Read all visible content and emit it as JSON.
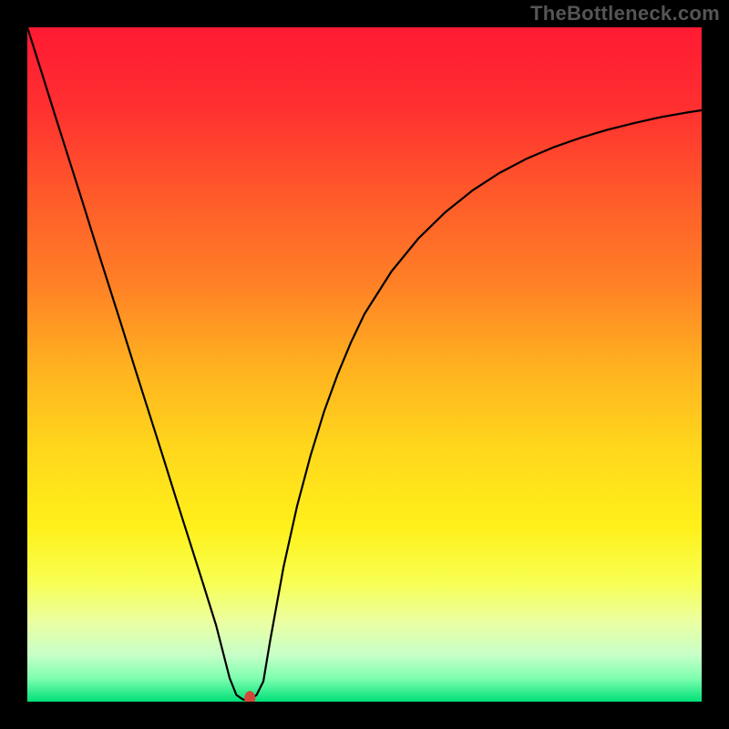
{
  "watermark": "TheBottleneck.com",
  "chart_data": {
    "type": "line",
    "title": "",
    "xlabel": "",
    "ylabel": "",
    "xlim": [
      0,
      100
    ],
    "ylim": [
      0,
      100
    ],
    "grid": false,
    "legend": false,
    "background": {
      "type": "vertical-gradient",
      "stops": [
        {
          "pos": 0.0,
          "color": "#ff1a33"
        },
        {
          "pos": 0.12,
          "color": "#ff3030"
        },
        {
          "pos": 0.25,
          "color": "#ff5a2a"
        },
        {
          "pos": 0.38,
          "color": "#ff8026"
        },
        {
          "pos": 0.5,
          "color": "#ffb020"
        },
        {
          "pos": 0.62,
          "color": "#ffd61c"
        },
        {
          "pos": 0.74,
          "color": "#fff01a"
        },
        {
          "pos": 0.82,
          "color": "#f8ff50"
        },
        {
          "pos": 0.88,
          "color": "#ecffa0"
        },
        {
          "pos": 0.93,
          "color": "#c8ffc8"
        },
        {
          "pos": 0.965,
          "color": "#7fffb0"
        },
        {
          "pos": 1.0,
          "color": "#00e078"
        }
      ]
    },
    "series": [
      {
        "name": "bottleneck-curve",
        "color": "#000000",
        "x": [
          0.0,
          2.0,
          4.0,
          6.0,
          8.0,
          10.0,
          12.0,
          14.0,
          16.0,
          18.0,
          20.0,
          22.0,
          24.0,
          26.0,
          28.0,
          30.0,
          31.0,
          32.0,
          33.0,
          34.0,
          35.0,
          36.0,
          38.0,
          40.0,
          42.0,
          44.0,
          46.0,
          48.0,
          50.0,
          54.0,
          58.0,
          62.0,
          66.0,
          70.0,
          74.0,
          78.0,
          82.0,
          86.0,
          90.0,
          94.0,
          98.0,
          100.0
        ],
        "y": [
          100.0,
          93.7,
          87.3,
          81.0,
          74.7,
          68.3,
          62.0,
          55.7,
          49.3,
          43.0,
          36.7,
          30.3,
          24.0,
          17.7,
          11.3,
          3.5,
          1.0,
          0.3,
          0.3,
          1.0,
          3.0,
          9.0,
          20.0,
          29.0,
          36.5,
          43.0,
          48.5,
          53.3,
          57.5,
          63.8,
          68.7,
          72.6,
          75.8,
          78.4,
          80.5,
          82.2,
          83.6,
          84.8,
          85.8,
          86.7,
          87.4,
          87.7
        ]
      }
    ],
    "marker": {
      "name": "optimal-point",
      "x": 33.0,
      "y": 0.5,
      "color": "#d4463a",
      "rx": 6,
      "ry": 8
    }
  }
}
